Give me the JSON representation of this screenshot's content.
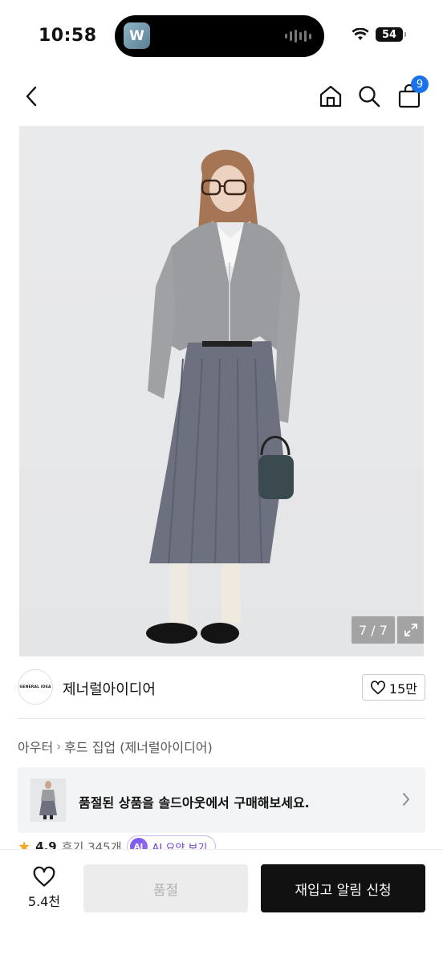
{
  "status_bar": {
    "time": "10:58",
    "battery": "54",
    "island_app_letter": "W"
  },
  "nav": {
    "cart_count": "9",
    "icons": [
      "back-icon",
      "home-icon",
      "search-icon",
      "shopping-bag-icon"
    ]
  },
  "product_image": {
    "counter": "7 / 7"
  },
  "brand": {
    "logo_text": "GENERAL IDEA",
    "name": "제너럴아이디어",
    "likes": "15만"
  },
  "breadcrumb": {
    "category": "아우터",
    "subcategory": "후드 집업 (제너럴아이디어)"
  },
  "soldout_banner": {
    "text": "품절된 상품을 솔드아웃에서 구매해보세요."
  },
  "rating": {
    "score": "4.9",
    "reviews": "후기 345개",
    "ai_label": "AI",
    "ai_text": "AI 요약 보기"
  },
  "bottom_bar": {
    "wish_count": "5.4천",
    "soldout_label": "품절",
    "restock_label": "재입고 알림 신청"
  },
  "colors": {
    "badge_blue": "#1a73e8",
    "primary_black": "#111111",
    "disabled_gray": "#ececec",
    "star": "#f5a623",
    "ai_purple": "#6a3fd6"
  }
}
